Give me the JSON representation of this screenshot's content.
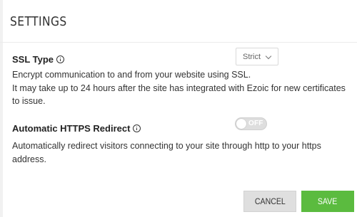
{
  "title": "SETTINGS",
  "ssl": {
    "label": "SSL Type",
    "select_value": "Strict",
    "description_line1": "Encrypt communication to and from your website using SSL.",
    "description_line2": "It may take up to 24 hours after the site has integrated with Ezoic for new certificates to issue."
  },
  "https_redirect": {
    "label": "Automatic HTTPS Redirect",
    "toggle_text": "OFF",
    "toggle_on": false,
    "description": "Automatically redirect visitors connecting to your site through http to your https address."
  },
  "buttons": {
    "cancel": "CANCEL",
    "save": "SAVE"
  },
  "colors": {
    "save_button": "#5bbb3f",
    "cancel_button": "#dfdfdf",
    "toggle_off": "#dedede"
  }
}
